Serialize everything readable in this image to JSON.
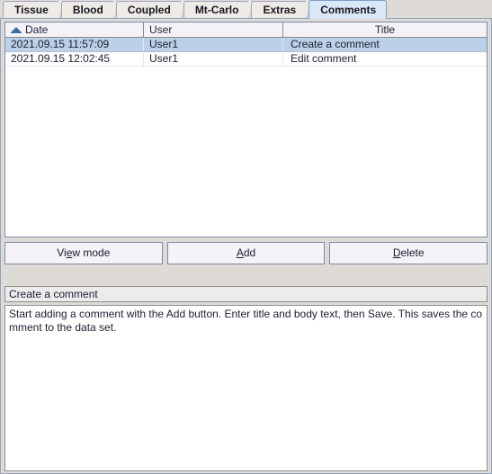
{
  "tabs": [
    {
      "label": "Tissue",
      "selected": false
    },
    {
      "label": "Blood",
      "selected": false
    },
    {
      "label": "Coupled",
      "selected": false
    },
    {
      "label": "Mt-Carlo",
      "selected": false
    },
    {
      "label": "Extras",
      "selected": false
    },
    {
      "label": "Comments",
      "selected": true
    }
  ],
  "table": {
    "sort_column": "Date",
    "sort_direction": "ascending",
    "sort_icon": "triangle-up-icon",
    "columns": [
      {
        "key": "date",
        "label": "Date"
      },
      {
        "key": "user",
        "label": "User"
      },
      {
        "key": "title",
        "label": "Title"
      }
    ],
    "rows": [
      {
        "date": "2021.09.15 11:57:09",
        "user": "User1",
        "title": "Create a comment",
        "selected": true
      },
      {
        "date": "2021.09.15 12:02:45",
        "user": "User1",
        "title": "Edit comment",
        "selected": false
      }
    ]
  },
  "buttons": {
    "view_mode": {
      "pre": "Vi",
      "mnemonic": "e",
      "post": "w mode"
    },
    "add": {
      "pre": "",
      "mnemonic": "A",
      "post": "dd"
    },
    "delete": {
      "pre": "",
      "mnemonic": "D",
      "post": "elete"
    }
  },
  "detail": {
    "title_value": "Create a comment",
    "body_value": "Start adding a comment with the Add button. Enter title and body text, then Save. This saves the comment to the data set."
  },
  "colors": {
    "selected_row": "#bcd0e7",
    "active_tab": "#d9e7f7",
    "panel": "#dedad6",
    "sort_arrow": "#3d6ea3"
  }
}
